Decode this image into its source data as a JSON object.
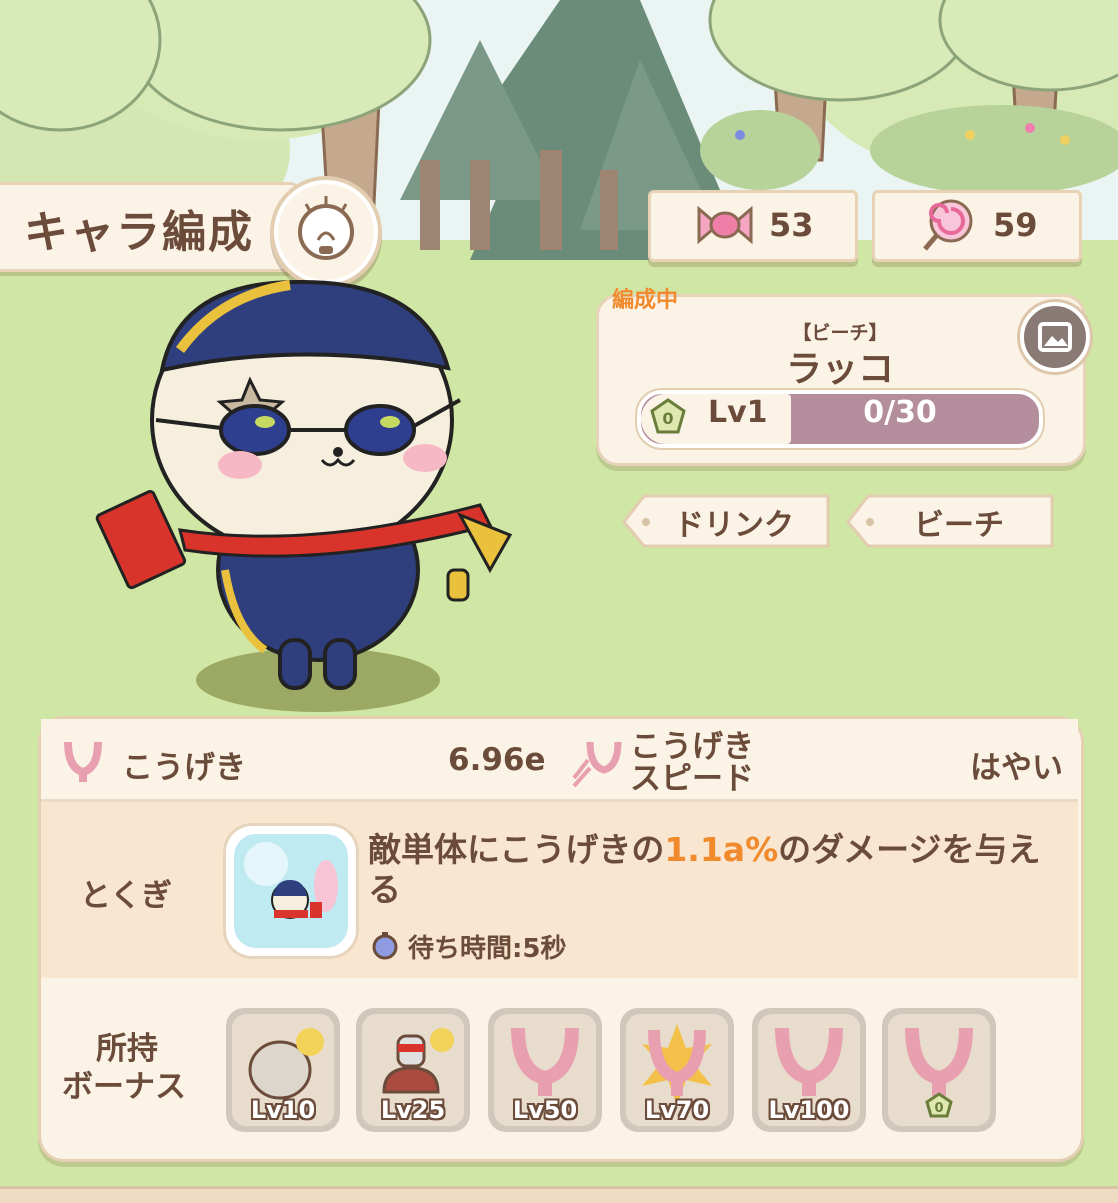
{
  "header": {
    "title": "キャラ編成"
  },
  "currencies": [
    {
      "name": "candy",
      "value": "53"
    },
    {
      "name": "lollipop",
      "value": "59"
    }
  ],
  "character": {
    "status_label": "編成中",
    "subname": "【ビーチ】",
    "name": "ラッコ",
    "rank_badge": "0",
    "level": "Lv1",
    "exp": "0/30",
    "exp_progress": 0.0
  },
  "tags": [
    "ドリンク",
    "ビーチ"
  ],
  "stats": {
    "attack_label": "こうげき",
    "attack_value": "6.96e",
    "speed_label_line1": "こうげき",
    "speed_label_line2": "スピード",
    "speed_value": "はやい"
  },
  "skill": {
    "label": "とくぎ",
    "desc_prefix": "敵単体にこうげきの",
    "desc_highlight": "1.1a%",
    "desc_suffix": "のダメージを与える",
    "cooldown": "待ち時間:5秒"
  },
  "bonus": {
    "label_line1": "所持",
    "label_line2": "ボーナス",
    "items": [
      {
        "level": "Lv10",
        "icon": "ghost-bonus-icon"
      },
      {
        "level": "Lv25",
        "icon": "robot-bonus-icon"
      },
      {
        "level": "Lv50",
        "icon": "attack-bonus-icon"
      },
      {
        "level": "Lv70",
        "icon": "attack-burst-bonus-icon"
      },
      {
        "level": "Lv100",
        "icon": "attack-bonus-icon"
      },
      {
        "level": "0",
        "icon": "attack-bonus-icon"
      }
    ]
  },
  "colors": {
    "accent": "#f08a2c",
    "text": "#6b4b3a",
    "panel": "#fbf3e6",
    "grass": "#cfe6a4"
  }
}
